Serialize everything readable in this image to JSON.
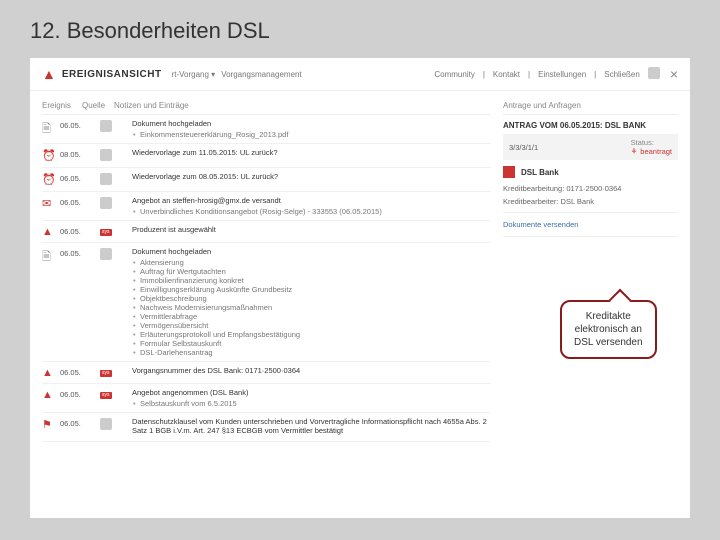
{
  "slide": {
    "title": "12. Besonderheiten DSL"
  },
  "header": {
    "app_label": "EREIGNISANSICHT",
    "menu": [
      "rt-Vorgang ▾",
      "Vorgangsmanagement"
    ],
    "right": [
      "Community",
      "Kontakt",
      "Einstellungen",
      "Schließen"
    ]
  },
  "columns": {
    "ereignis": "Ereignis",
    "quelle": "Quelle",
    "notizen": "Notizen und Einträge"
  },
  "events": [
    {
      "icon": "doc",
      "date": "06.05.",
      "quelle": "avatar",
      "title": "Dokument hochgeladen",
      "subs": [
        "Einkommensteuererklärung_Rosig_2013.pdf"
      ]
    },
    {
      "icon": "clock",
      "date": "08.05.",
      "quelle": "avatar",
      "title": "Wiedervorlage zum 11.05.2015: UL zurück?",
      "subs": []
    },
    {
      "icon": "clock",
      "date": "06.05.",
      "quelle": "avatar",
      "title": "Wiedervorlage zum 08.05.2015: UL zurück?",
      "subs": []
    },
    {
      "icon": "mail",
      "date": "06.05.",
      "quelle": "avatar",
      "title": "Angebot an steffen-hrosig@gmx.de versandt",
      "subs": [
        "Unverbindliches Konditionsangebot (Rosig-Selge) - 333553 (06.05.2015)"
      ]
    },
    {
      "icon": "bell",
      "date": "06.05.",
      "quelle": "sys",
      "title": "Produzent ist ausgewählt",
      "subs": []
    },
    {
      "icon": "doc",
      "date": "06.05.",
      "quelle": "avatar",
      "title": "Dokument hochgeladen",
      "subs": [
        "Aktensierung",
        "Auftrag für Wertgutachten",
        "Immobilienfinanzierung konkret",
        "Einwilligungserklärung Auskünfte Grundbesitz",
        "Objektbeschreibung",
        "Nachweis Modernisierungsmaßnahmen",
        "Vermittlerabfrage",
        "Vermögensübersicht",
        "Erläuterungsprotokoll und Empfangsbestätigung",
        "Formular Selbstauskunft",
        "DSL-Darlehensantrag"
      ]
    },
    {
      "icon": "bell",
      "date": "06.05.",
      "quelle": "sys",
      "title": "Vorgangsnummer des DSL Bank: 0171·2500·0364",
      "subs": []
    },
    {
      "icon": "bell",
      "date": "06.05.",
      "quelle": "sys",
      "title": "Angebot angenommen (DSL Bank)",
      "subs": [
        "Selbstauskunft vom 6.5.2015"
      ]
    },
    {
      "icon": "flag",
      "date": "06.05.",
      "quelle": "avatar",
      "title": "Datenschutzklausel vom Kunden unterschrieben und Vorvertragliche Informationspflicht nach 4655a Abs. 2 Satz 1 BGB i.V.m. Art. 247 §13 ECBGB vom Vermittler bestätigt",
      "subs": []
    }
  ],
  "side": {
    "header": "Antrage und Anfragen",
    "antrag_title": "ANTRAG VOM 06.05.2015: DSL BANK",
    "antrag_id": "3/3/3/1/1",
    "status_label": "Status:",
    "status_value": "beantragt",
    "bank_name": "DSL Bank",
    "bank_line1": "Kreditbearbeitung: 0171·2500·0364",
    "bank_line2": "Kreditbearbeiter: DSL Bank",
    "send_link": "Dokumente versenden"
  },
  "callout": {
    "l1": "Kreditakte",
    "l2": "elektronisch an",
    "l3": "DSL versenden"
  }
}
